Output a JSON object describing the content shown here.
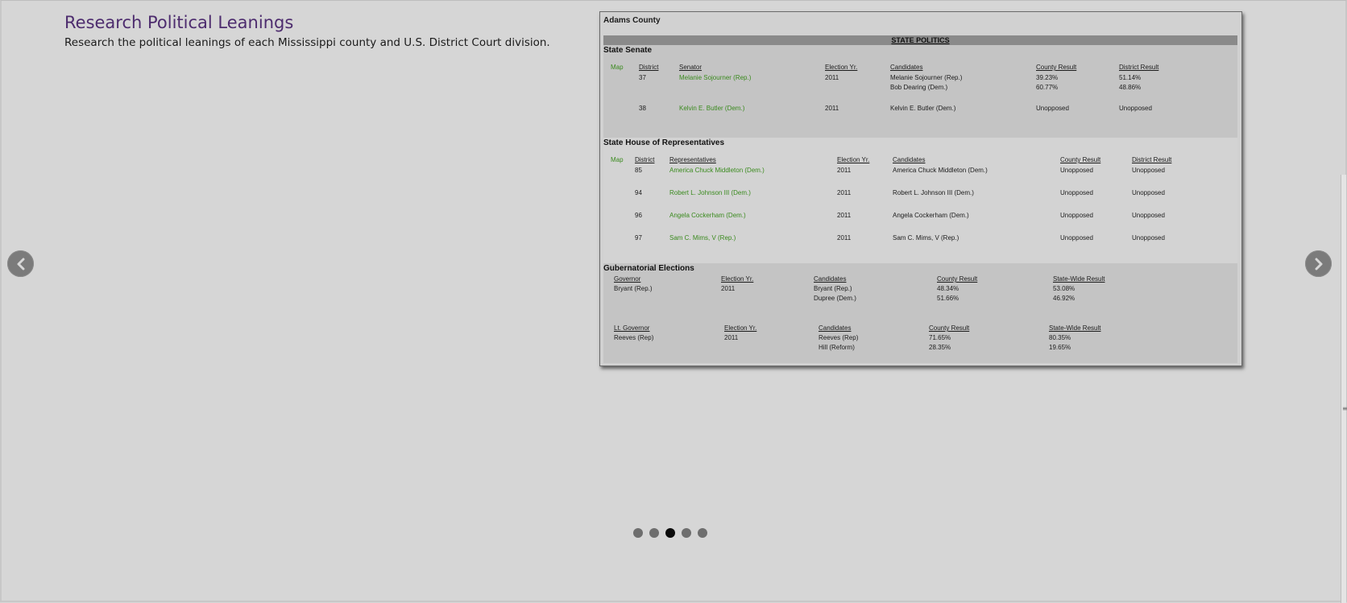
{
  "page": {
    "title": "Research Political Leanings",
    "subtitle": "Research the political leanings of each Mississippi county and U.S. District Court division."
  },
  "icons": {
    "prev": "chevron-left-icon",
    "next": "chevron-right-icon"
  },
  "carousel": {
    "total": 5,
    "active": 3
  },
  "slide": {
    "county": "Adams County",
    "state_politics": "STATE POLITICS",
    "senate": {
      "title": "State Senate",
      "headers": [
        "Map",
        "District",
        "Senator",
        "Election Yr.",
        "Candidates",
        "County Result",
        "District Result"
      ],
      "rows": [
        {
          "district": "37",
          "senator": "Melanie Sojourner (Rep.)",
          "year": "2011",
          "candidates": [
            "Melanie Sojourner (Rep.)",
            "Bob Dearing (Dem.)"
          ],
          "county": [
            "39.23%",
            "60.77%"
          ],
          "district_result": [
            "51.14%",
            "48.86%"
          ]
        },
        {
          "district": "38",
          "senator": "Kelvin E. Butler (Dem.)",
          "year": "2011",
          "candidates": [
            "Kelvin E. Butler (Dem.)"
          ],
          "county": [
            "Unopposed"
          ],
          "district_result": [
            "Unopposed"
          ]
        }
      ]
    },
    "house": {
      "title": "State House of Representatives",
      "headers": [
        "Map",
        "District",
        "Representatives",
        "Election Yr.",
        "Candidates",
        "County Result",
        "District Result"
      ],
      "rows": [
        {
          "district": "85",
          "rep": "America Chuck Middleton (Dem.)",
          "year": "2011",
          "candidate": "America Chuck Middleton (Dem.)",
          "county": "Unopposed",
          "district_result": "Unopposed"
        },
        {
          "district": "94",
          "rep": "Robert L. Johnson III (Dem.)",
          "year": "2011",
          "candidate": "Robert L. Johnson III (Dem.)",
          "county": "Unopposed",
          "district_result": "Unopposed"
        },
        {
          "district": "96",
          "rep": "Angela Cockerham (Dem.)",
          "year": "2011",
          "candidate": "Angela Cockerham (Dem.)",
          "county": "Unopposed",
          "district_result": "Unopposed"
        },
        {
          "district": "97",
          "rep": "Sam C. Mims, V (Rep.)",
          "year": "2011",
          "candidate": "Sam C. Mims, V (Rep.)",
          "county": "Unopposed",
          "district_result": "Unopposed"
        }
      ]
    },
    "gubernatorial": {
      "title": "Gubernatorial Elections",
      "governor": {
        "headers": [
          "Governor",
          "Election Yr.",
          "Candidates",
          "County Result",
          "State-Wide Result"
        ],
        "winner": "Bryant (Rep.)",
        "year": "2011",
        "candidates": [
          "Bryant (Rep.)",
          "Dupree (Dem.)"
        ],
        "county": [
          "48.34%",
          "51.66%"
        ],
        "statewide": [
          "53.08%",
          "46.92%"
        ]
      },
      "lt_governor": {
        "headers": [
          "Lt. Governor",
          "Election Yr.",
          "Candidates",
          "County Result",
          "State-Wide Result"
        ],
        "winner": "Reeves (Rep)",
        "year": "2011",
        "candidates": [
          "Reeves (Rep)",
          "Hill (Reform)"
        ],
        "county": [
          "71.65%",
          "28.35%"
        ],
        "statewide": [
          "80.35%",
          "19.65%"
        ]
      }
    }
  }
}
